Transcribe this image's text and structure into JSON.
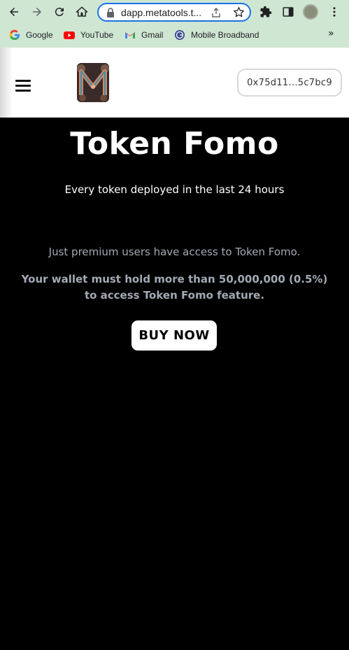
{
  "browser": {
    "url": "dapp.metatools.t...",
    "icons": {
      "back": "back-arrow-icon",
      "forward": "forward-arrow-icon",
      "reload": "reload-icon",
      "home": "home-icon",
      "lock": "lock-icon",
      "share": "share-icon",
      "bookmark": "star-icon",
      "extensions": "puzzle-icon",
      "sidepanel": "side-panel-icon",
      "profile": "profile-avatar",
      "menu": "kebab-menu-icon"
    },
    "bookmarks": [
      {
        "label": "Google",
        "icon": "google-icon"
      },
      {
        "label": "YouTube",
        "icon": "youtube-icon"
      },
      {
        "label": "Gmail",
        "icon": "gmail-icon"
      },
      {
        "label": "Mobile Broadband",
        "icon": "globe-icon"
      }
    ],
    "more_bookmarks": "»",
    "colors": {
      "frame": "#cfe6d2",
      "focus": "#1a73e8"
    }
  },
  "header": {
    "wallet_address": "0x75d11...5c7bc9",
    "logo": "metatools-m-logo",
    "menu_icon": "hamburger-icon"
  },
  "main": {
    "title": "Token Fomo",
    "subtitle": "Every token deployed in the last 24 hours",
    "notice": "Just premium users have access to Token Fomo.",
    "requirement": "Your wallet must hold more than 50,000,000 (0.5%) to access Token Fomo feature.",
    "buy_label": "BUY NOW"
  },
  "colors": {
    "page_bg": "#000000",
    "muted_text": "#a4a9b6",
    "header_bg": "#ffffff"
  }
}
